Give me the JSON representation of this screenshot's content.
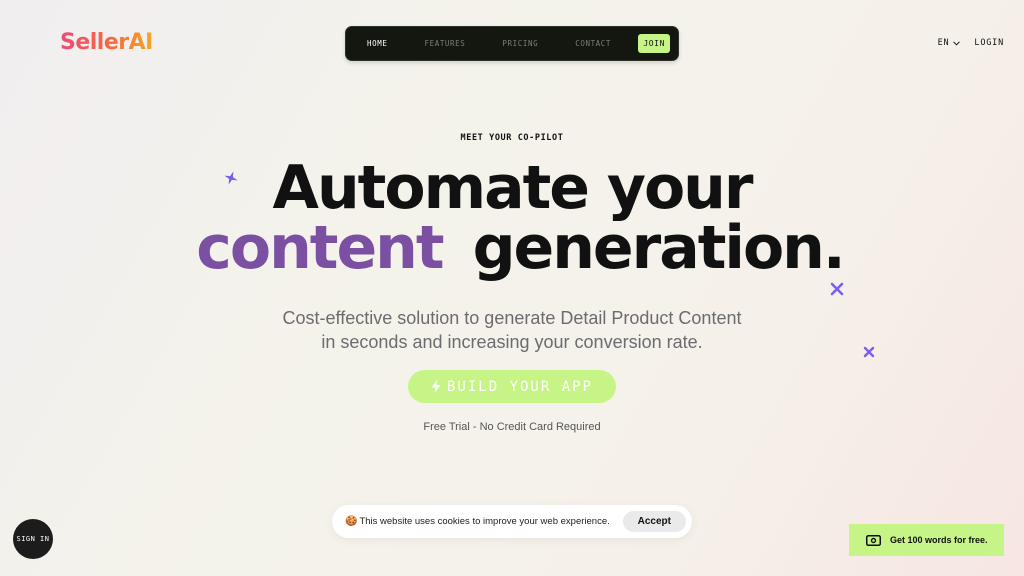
{
  "brand": {
    "name": "SellerAI"
  },
  "nav": {
    "items": [
      {
        "label": "HOME",
        "active": true
      },
      {
        "label": "FEATURES"
      },
      {
        "label": "PRICING"
      },
      {
        "label": "CONTACT"
      }
    ],
    "join": "JOIN"
  },
  "header": {
    "language": "EN",
    "login": "LOGIN"
  },
  "hero": {
    "eyebrow": "MEET YOUR CO-PILOT",
    "line1": "Automate your",
    "line2_highlight": "content",
    "line2_rest": "generation.",
    "subtitle_line1": "Cost-effective solution to generate Detail Product Content",
    "subtitle_line2": "in seconds and increasing your conversion rate.",
    "cta": "BUILD YOUR APP",
    "note": "Free Trial - No Credit Card Required"
  },
  "signin": "SIGN IN",
  "cookie": {
    "text": "This website uses cookies to improve your web experience.",
    "accept": "Accept"
  },
  "promo": "Get 100 words for free.",
  "colors": {
    "accent": "#c6f486",
    "purple": "#7b4fa1",
    "nav_bg": "#141710",
    "sparkle": "#7c5cf0"
  },
  "icons": [
    "lightning-icon",
    "chevron-down-icon",
    "cookie-icon",
    "money-icon",
    "sparkle-icon"
  ]
}
